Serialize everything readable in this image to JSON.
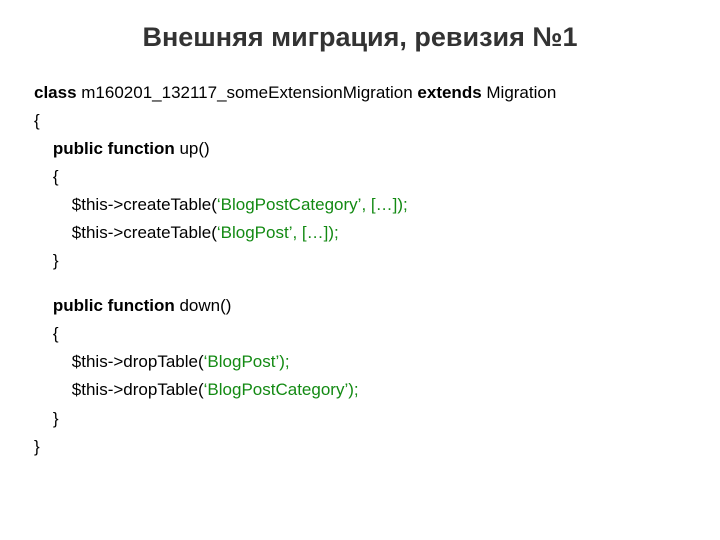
{
  "title": "Внешняя миграция, ревизия №1",
  "code": {
    "kw_class": "class",
    "class_name": " m160201_132117_someExtensionMigration ",
    "kw_extends": "extends",
    "parent": " Migration",
    "brace_open": "{",
    "indent1": "    ",
    "indent2": "        ",
    "kw_pubfun": "public function",
    "fn_up": " up()",
    "fn_down": " down()",
    "brace_open2": "    {",
    "brace_close2": "    }",
    "brace_close": "}",
    "this": "$this",
    "arrow_create": "->createTable(",
    "arrow_drop": "->dropTable(",
    "q_open": "‘",
    "q_close_args": "’, […]);",
    "q_close_paren": "’);",
    "str_blogpostcat": "BlogPostCategory",
    "str_blogpost": "BlogPost"
  }
}
